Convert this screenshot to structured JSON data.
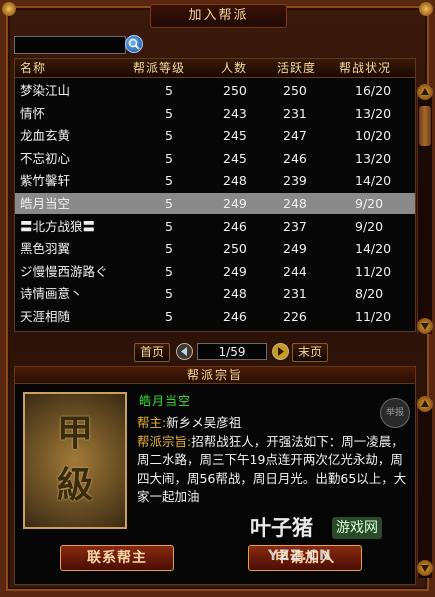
{
  "window": {
    "title": "加入帮派"
  },
  "search": {
    "value": "",
    "icon": "search-icon"
  },
  "table": {
    "headers": [
      "名称",
      "帮派等级",
      "人数",
      "活跃度",
      "帮战状况"
    ],
    "rows": [
      {
        "name": "梦染江山",
        "level": "5",
        "members": "250",
        "activity": "250",
        "war": "16/20"
      },
      {
        "name": "情怀",
        "level": "5",
        "members": "243",
        "activity": "231",
        "war": "13/20"
      },
      {
        "name": "龙血玄黄",
        "level": "5",
        "members": "245",
        "activity": "247",
        "war": "10/20"
      },
      {
        "name": "不忘初心",
        "level": "5",
        "members": "245",
        "activity": "246",
        "war": "13/20"
      },
      {
        "name": "紫竹馨轩",
        "level": "5",
        "members": "248",
        "activity": "239",
        "war": "14/20"
      },
      {
        "name": "皓月当空",
        "level": "5",
        "members": "249",
        "activity": "248",
        "war": "9/20"
      },
      {
        "name": "〓北方战狼〓",
        "level": "5",
        "members": "246",
        "activity": "237",
        "war": "9/20"
      },
      {
        "name": "黑色羽翼",
        "level": "5",
        "members": "250",
        "activity": "249",
        "war": "14/20"
      },
      {
        "name": "ジ慢慢西游路ぐ",
        "level": "5",
        "members": "249",
        "activity": "244",
        "war": "11/20"
      },
      {
        "name": "诗情画意丶",
        "level": "5",
        "members": "248",
        "activity": "231",
        "war": "8/20"
      },
      {
        "name": "天涯相随",
        "level": "5",
        "members": "246",
        "activity": "226",
        "war": "11/20"
      }
    ],
    "selected_index": 5
  },
  "pager": {
    "first": "首页",
    "page": "1/59",
    "last": "末页"
  },
  "detail": {
    "banner": "帮派宗旨",
    "emblem": [
      "甲",
      "級"
    ],
    "guild_name": "皓月当空",
    "leader_label": "帮主:",
    "leader": "新乡メ吴彦祖",
    "purpose_label": "帮派宗旨:",
    "purpose": "招帮战狂人，开强法如下：周一凌晨，周二水路，周三下午19点连开两次亿光永劫，周四大闹，周56帮战，周日月光。出勤65以上，大家一起加油",
    "report": "举报"
  },
  "buttons": {
    "contact": "联系帮主",
    "apply": "申请加入"
  },
  "watermark": {
    "logo": "叶子猪",
    "tag": "游戏网",
    "url": "YZZ.CN"
  },
  "colors": {
    "selected_row": "#8a8a8a",
    "guild_name": "#33e033",
    "label": "#e8b030",
    "text": "#f2f2f2"
  }
}
